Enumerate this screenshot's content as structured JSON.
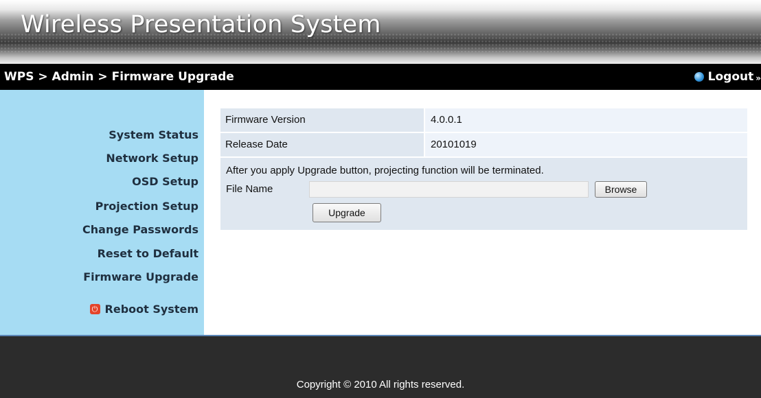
{
  "header": {
    "app_title": "Wireless Presentation System",
    "breadcrumb": "WPS > Admin > Firmware Upgrade",
    "logout_label": "Logout",
    "logout_arrows": "»"
  },
  "sidebar": {
    "items": [
      {
        "label": "System Status"
      },
      {
        "label": "Network Setup"
      },
      {
        "label": "OSD Setup"
      },
      {
        "label": "Projection Setup"
      },
      {
        "label": "Change Passwords"
      },
      {
        "label": "Reset to Default"
      },
      {
        "label": "Firmware Upgrade"
      }
    ],
    "reboot_label": "Reboot System",
    "reboot_icon": "power-icon",
    "reboot_icon_color": "#e4442a"
  },
  "main": {
    "info_rows": [
      {
        "label": "Firmware Version",
        "value": "4.0.0.1"
      },
      {
        "label": "Release Date",
        "value": "20101019"
      }
    ],
    "warning_text": "After you apply Upgrade button, projecting function will be terminated.",
    "file_label": "File Name",
    "file_value": "",
    "browse_label": "Browse",
    "upgrade_label": "Upgrade"
  },
  "footer": {
    "copyright": "Copyright © 2010 All rights reserved."
  },
  "colors": {
    "sidebar_bg": "#a6dcf3",
    "crumbbar_bg": "#000000",
    "footer_bg": "#2c2c2c",
    "table_label_bg": "#dfe7f0",
    "table_value_bg": "#eef3fa"
  }
}
